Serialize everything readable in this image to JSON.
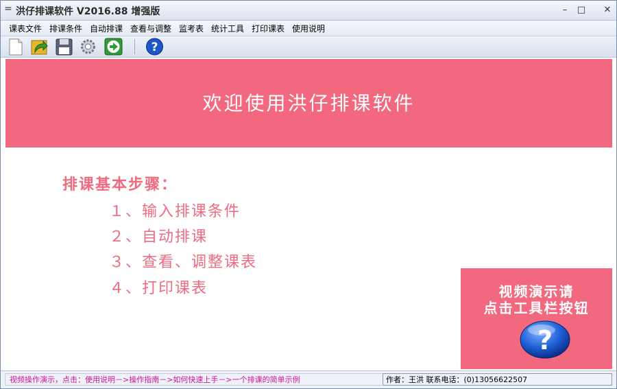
{
  "window": {
    "title": "洪仔排课软件 V2016.88 增强版",
    "sysmenu_glyph": "=",
    "minimize_glyph": "–",
    "maximize_glyph": "□",
    "close_glyph": "✕"
  },
  "menu": {
    "items": [
      "课表文件",
      "排课条件",
      "自动排课",
      "查看与调整",
      "监考表",
      "统计工具",
      "打印课表",
      "使用说明"
    ]
  },
  "toolbar": {
    "icons": [
      "new-file-icon",
      "open-folder-icon",
      "save-disk-icon",
      "settings-gear-icon",
      "run-arrow-icon",
      "help-icon"
    ],
    "help_glyph": "?"
  },
  "banner": {
    "text": "欢迎使用洪仔排课软件"
  },
  "steps": {
    "title": "排课基本步骤：",
    "items": [
      "１、输入排课条件",
      "２、自动排课",
      "３、查看、调整课表",
      "４、打印课表"
    ]
  },
  "video_box": {
    "line1": "视频演示请",
    "line2": "点击工具栏按钮",
    "help_glyph": "?"
  },
  "status": {
    "left": "视频操作演示，点击：使用说明－>操作指南－>如何快速上手－>一个排课的简单示例",
    "right": "作者：王洪  联系电话：(0)13056622507"
  },
  "colors": {
    "accent": "#f2687e",
    "step_text": "#ef6b80",
    "status_text": "#d4109c"
  }
}
